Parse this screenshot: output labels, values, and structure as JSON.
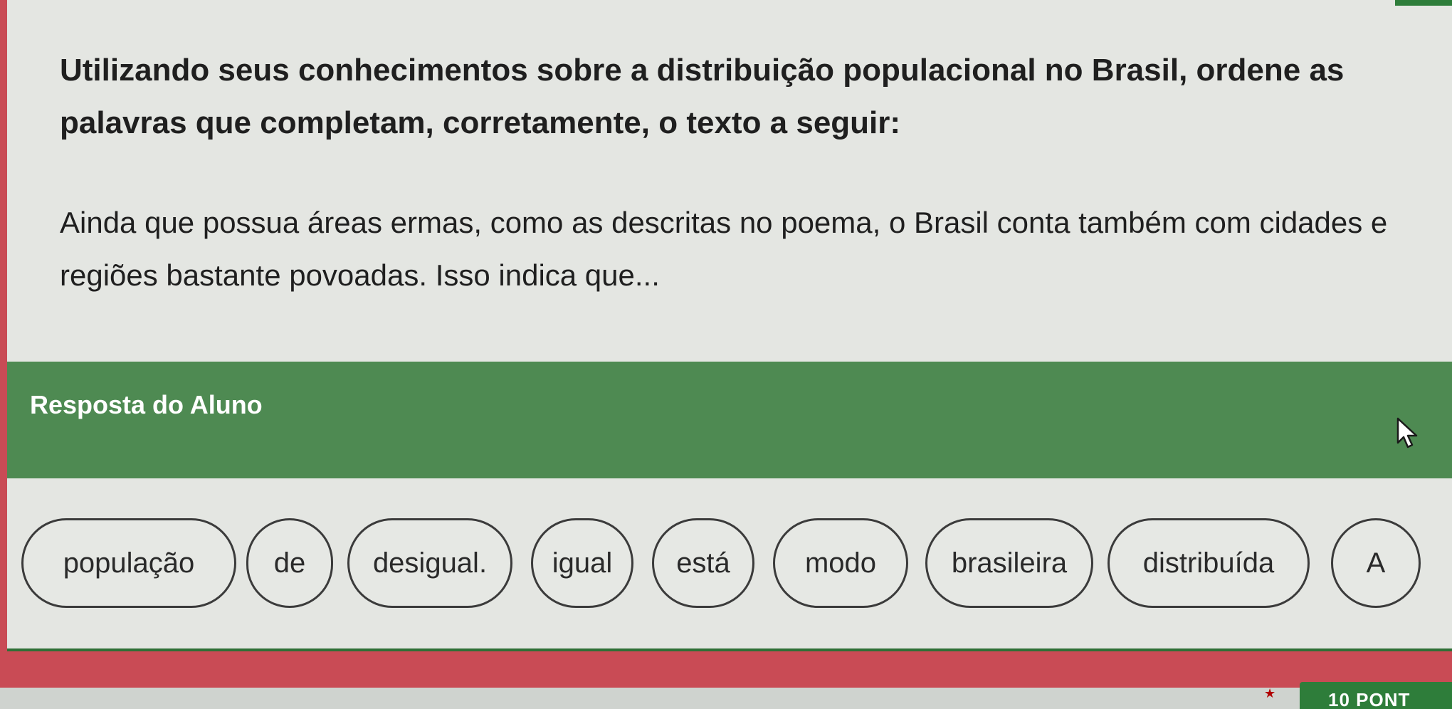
{
  "question": {
    "title": "Utilizando seus conhecimentos sobre a distribuição populacional no Brasil, ordene as palavras que completam, corretamente, o texto a seguir:",
    "text": "Ainda que possua áreas ermas, como as descritas no poema, o Brasil conta também com cidades e regiões bastante povoadas. Isso indica que..."
  },
  "answer": {
    "title": "Resposta do Aluno",
    "words": [
      "população",
      "de",
      "desigual.",
      "igual",
      "está",
      "modo",
      "brasileira",
      "distribuída",
      "A"
    ]
  },
  "footer": {
    "points_label": "10 PONT"
  },
  "icons": {
    "cursor": "mouse-pointer-icon",
    "star": "star-icon"
  },
  "colors": {
    "header_green": "#4e8a52",
    "accent_green": "#2e7d3a",
    "background_red": "#c94b55",
    "card": "#e4e6e2"
  }
}
